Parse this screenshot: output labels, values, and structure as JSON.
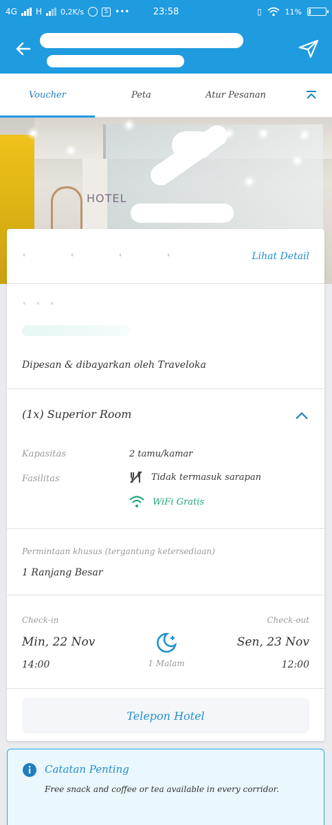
{
  "status_bar": {
    "network_1": "4G",
    "network_2": "H",
    "speed": "0,2K/s",
    "time": "23:58",
    "battery": "11%"
  },
  "app_bar": {
    "back_icon": "arrow-left-icon",
    "share_icon": "send-icon"
  },
  "tabs": [
    {
      "label": "Voucher",
      "active": true
    },
    {
      "label": "Peta",
      "active": false
    },
    {
      "label": "Atur Pesanan",
      "active": false
    }
  ],
  "hero": {
    "sign_text": "HOTEL"
  },
  "header": {
    "detail_link": "Lihat Detail"
  },
  "booker": {
    "paid_by": "Dipesan & dibayarkan oleh Traveloka"
  },
  "room": {
    "title": "(1x) Superior Room",
    "capacity_label": "Kapasitas",
    "capacity_value": "2 tamu/kamar",
    "facilities_label": "Fasilitas",
    "facilities": [
      {
        "icon": "no-breakfast-icon",
        "text": "Tidak termasuk sarapan"
      },
      {
        "icon": "wifi-icon",
        "text": "WiFi Gratis"
      }
    ]
  },
  "request": {
    "label": "Permintaan khusus (tergantung ketersediaan)",
    "value": "1 Ranjang Besar"
  },
  "dates": {
    "checkin_label": "Check-in",
    "checkin_date": "Min, 22 Nov",
    "checkin_time": "14:00",
    "checkout_label": "Check-out",
    "checkout_date": "Sen, 23 Nov",
    "checkout_time": "12:00",
    "nights": "1 Malam"
  },
  "actions": {
    "call_hotel": "Telepon Hotel"
  },
  "note": {
    "title": "Catatan Penting",
    "body": "Free snack and coffee or tea available in every corridor."
  },
  "colors": {
    "primary": "#1f9be0",
    "link": "#1f8fd0",
    "wifi": "#1fa57a",
    "note_bg": "#eaf7fd"
  }
}
